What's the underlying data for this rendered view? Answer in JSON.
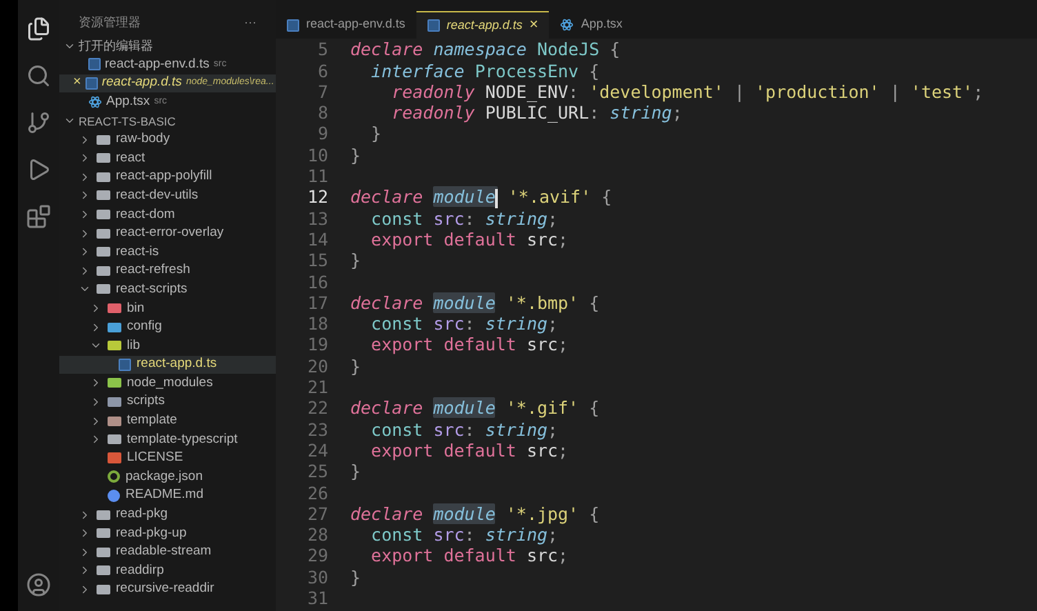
{
  "sidebar": {
    "title": "资源管理器",
    "more": "···",
    "open_editors": {
      "title": "打开的编辑器",
      "expanded": true,
      "items": [
        {
          "name": "react-app-env.d.ts",
          "description": "src",
          "kind": "ts",
          "active": false,
          "preview": false
        },
        {
          "name": "react-app.d.ts",
          "description": "node_modules\\rea...",
          "kind": "ts",
          "active": true,
          "preview": true,
          "close": "×"
        },
        {
          "name": "App.tsx",
          "description": "src",
          "kind": "react",
          "active": false,
          "preview": false
        }
      ]
    },
    "project": {
      "title": "REACT-TS-BASIC",
      "expanded": true,
      "items": [
        {
          "name": "raw-body",
          "kind": "folder",
          "expanded": false,
          "selected": false
        },
        {
          "name": "react",
          "kind": "folder",
          "expanded": false,
          "selected": false
        },
        {
          "name": "react-app-polyfill",
          "kind": "folder",
          "expanded": false,
          "selected": false
        },
        {
          "name": "react-dev-utils",
          "kind": "folder",
          "expanded": false,
          "selected": false
        },
        {
          "name": "react-dom",
          "kind": "folder",
          "expanded": false,
          "selected": false
        },
        {
          "name": "react-error-overlay",
          "kind": "folder",
          "expanded": false,
          "selected": false
        },
        {
          "name": "react-is",
          "kind": "folder",
          "expanded": false,
          "selected": false
        },
        {
          "name": "react-refresh",
          "kind": "folder",
          "expanded": false,
          "selected": false
        },
        {
          "name": "react-scripts",
          "kind": "folder",
          "expanded": true,
          "selected": false,
          "children": [
            {
              "name": "bin",
              "kind": "binfolder",
              "expanded": false,
              "selected": false
            },
            {
              "name": "config",
              "kind": "configfolder",
              "expanded": false,
              "selected": false
            },
            {
              "name": "lib",
              "kind": "libfolder",
              "expanded": true,
              "selected": false,
              "children": [
                {
                  "name": "react-app.d.ts",
                  "kind": "ts",
                  "selected": true
                }
              ]
            },
            {
              "name": "node_modules",
              "kind": "nodefolder",
              "expanded": false,
              "selected": false
            },
            {
              "name": "scripts",
              "kind": "scriptsfolder",
              "expanded": false,
              "selected": false
            },
            {
              "name": "template",
              "kind": "templatefolder",
              "expanded": false,
              "selected": false
            },
            {
              "name": "template-typescript",
              "kind": "folder",
              "expanded": false,
              "selected": false
            },
            {
              "name": "LICENSE",
              "kind": "license",
              "selected": false
            },
            {
              "name": "package.json",
              "kind": "json",
              "selected": false
            },
            {
              "name": "README.md",
              "kind": "info",
              "selected": false
            }
          ]
        },
        {
          "name": "read-pkg",
          "kind": "folder",
          "expanded": false,
          "selected": false
        },
        {
          "name": "read-pkg-up",
          "kind": "folder",
          "expanded": false,
          "selected": false
        },
        {
          "name": "readable-stream",
          "kind": "folder",
          "expanded": false,
          "selected": false
        },
        {
          "name": "readdirp",
          "kind": "folder",
          "expanded": false,
          "selected": false
        },
        {
          "name": "recursive-readdir",
          "kind": "folder",
          "expanded": false,
          "selected": false
        }
      ]
    }
  },
  "tabs": [
    {
      "label": "react-app-env.d.ts",
      "kind": "ts",
      "selected": false,
      "preview": false
    },
    {
      "label": "react-app.d.ts",
      "kind": "ts",
      "selected": true,
      "preview": true,
      "close": "×"
    },
    {
      "label": "App.tsx",
      "kind": "react",
      "selected": false,
      "preview": false
    }
  ],
  "editor": {
    "lines": [
      {
        "number": "5",
        "current": false,
        "tokens": [
          {
            "text": "declare",
            "kind": "keyword"
          },
          {
            "text": " namespace",
            "kind": "modifier"
          },
          {
            "text": " NodeJS",
            "kind": "entity"
          },
          {
            "text": " {",
            "kind": "punct"
          }
        ]
      },
      {
        "number": "6",
        "current": false,
        "tokens": [
          {
            "text": "  interface",
            "kind": "modifier"
          },
          {
            "text": " ProcessEnv",
            "kind": "entity"
          },
          {
            "text": " {",
            "kind": "punct"
          }
        ]
      },
      {
        "number": "7",
        "current": false,
        "tokens": [
          {
            "text": "    readonly",
            "kind": "keyword"
          },
          {
            "text": " NODE_ENV",
            "kind": "plain"
          },
          {
            "text": ":",
            "kind": "punct"
          },
          {
            "text": " 'development'",
            "kind": "string"
          },
          {
            "text": " |",
            "kind": "punct"
          },
          {
            "text": " 'production'",
            "kind": "string"
          },
          {
            "text": " |",
            "kind": "punct"
          },
          {
            "text": " 'test'",
            "kind": "string"
          },
          {
            "text": ";",
            "kind": "punct"
          }
        ]
      },
      {
        "number": "8",
        "current": false,
        "tokens": [
          {
            "text": "    readonly",
            "kind": "keyword"
          },
          {
            "text": " PUBLIC_URL",
            "kind": "plain"
          },
          {
            "text": ":",
            "kind": "punct"
          },
          {
            "text": " string",
            "kind": "modifier"
          },
          {
            "text": ";",
            "kind": "punct"
          }
        ]
      },
      {
        "number": "9",
        "current": false,
        "tokens": [
          {
            "text": "  }",
            "kind": "punct"
          }
        ]
      },
      {
        "number": "10",
        "current": false,
        "tokens": [
          {
            "text": "}",
            "kind": "punct"
          }
        ]
      },
      {
        "number": "11",
        "current": false
      },
      {
        "number": "12",
        "current": true,
        "tokens": [
          {
            "text": "declare ",
            "kind": "keyword"
          },
          {
            "text": "module",
            "kind": "modifier",
            "highlighted": true,
            "cursor": true
          },
          {
            "text": " '*.avif'",
            "kind": "string"
          },
          {
            "text": " {",
            "kind": "punct"
          }
        ]
      },
      {
        "number": "13",
        "current": false,
        "tokens": [
          {
            "text": "  const",
            "kind": "entity"
          },
          {
            "text": " src",
            "kind": "variable"
          },
          {
            "text": ":",
            "kind": "punct"
          },
          {
            "text": " string",
            "kind": "modifier"
          },
          {
            "text": ";",
            "kind": "punct"
          }
        ]
      },
      {
        "number": "14",
        "current": false,
        "tokens": [
          {
            "text": "  export default",
            "kind": "control"
          },
          {
            "text": " src",
            "kind": "plain"
          },
          {
            "text": ";",
            "kind": "punct"
          }
        ]
      },
      {
        "number": "15",
        "current": false,
        "tokens": [
          {
            "text": "}",
            "kind": "punct"
          }
        ]
      },
      {
        "number": "16",
        "current": false
      },
      {
        "number": "17",
        "current": false,
        "tokens": [
          {
            "text": "declare ",
            "kind": "keyword"
          },
          {
            "text": "module",
            "kind": "modifier",
            "highlighted": true,
            "cursor": false
          },
          {
            "text": " '*.bmp'",
            "kind": "string"
          },
          {
            "text": " {",
            "kind": "punct"
          }
        ]
      },
      {
        "number": "18",
        "current": false,
        "tokens": [
          {
            "text": "  const",
            "kind": "entity"
          },
          {
            "text": " src",
            "kind": "variable"
          },
          {
            "text": ":",
            "kind": "punct"
          },
          {
            "text": " string",
            "kind": "modifier"
          },
          {
            "text": ";",
            "kind": "punct"
          }
        ]
      },
      {
        "number": "19",
        "current": false,
        "tokens": [
          {
            "text": "  export default",
            "kind": "control"
          },
          {
            "text": " src",
            "kind": "plain"
          },
          {
            "text": ";",
            "kind": "punct"
          }
        ]
      },
      {
        "number": "20",
        "current": false,
        "tokens": [
          {
            "text": "}",
            "kind": "punct"
          }
        ]
      },
      {
        "number": "21",
        "current": false
      },
      {
        "number": "22",
        "current": false,
        "tokens": [
          {
            "text": "declare ",
            "kind": "keyword"
          },
          {
            "text": "module",
            "kind": "modifier",
            "highlighted": true,
            "cursor": false
          },
          {
            "text": " '*.gif'",
            "kind": "string"
          },
          {
            "text": " {",
            "kind": "punct"
          }
        ]
      },
      {
        "number": "23",
        "current": false,
        "tokens": [
          {
            "text": "  const",
            "kind": "entity"
          },
          {
            "text": " src",
            "kind": "variable"
          },
          {
            "text": ":",
            "kind": "punct"
          },
          {
            "text": " string",
            "kind": "modifier"
          },
          {
            "text": ";",
            "kind": "punct"
          }
        ]
      },
      {
        "number": "24",
        "current": false,
        "tokens": [
          {
            "text": "  export default",
            "kind": "control"
          },
          {
            "text": " src",
            "kind": "plain"
          },
          {
            "text": ";",
            "kind": "punct"
          }
        ]
      },
      {
        "number": "25",
        "current": false,
        "tokens": [
          {
            "text": "}",
            "kind": "punct"
          }
        ]
      },
      {
        "number": "26",
        "current": false
      },
      {
        "number": "27",
        "current": false,
        "tokens": [
          {
            "text": "declare ",
            "kind": "keyword"
          },
          {
            "text": "module",
            "kind": "modifier",
            "highlighted": true,
            "cursor": false
          },
          {
            "text": " '*.jpg'",
            "kind": "string"
          },
          {
            "text": " {",
            "kind": "punct"
          }
        ]
      },
      {
        "number": "28",
        "current": false,
        "tokens": [
          {
            "text": "  const",
            "kind": "entity"
          },
          {
            "text": " src",
            "kind": "variable"
          },
          {
            "text": ":",
            "kind": "punct"
          },
          {
            "text": " string",
            "kind": "modifier"
          },
          {
            "text": ";",
            "kind": "punct"
          }
        ]
      },
      {
        "number": "29",
        "current": false,
        "tokens": [
          {
            "text": "  export default",
            "kind": "control"
          },
          {
            "text": " src",
            "kind": "plain"
          },
          {
            "text": ";",
            "kind": "punct"
          }
        ]
      },
      {
        "number": "30",
        "current": false,
        "tokens": [
          {
            "text": "}",
            "kind": "punct"
          }
        ]
      },
      {
        "number": "31",
        "current": false
      }
    ]
  }
}
